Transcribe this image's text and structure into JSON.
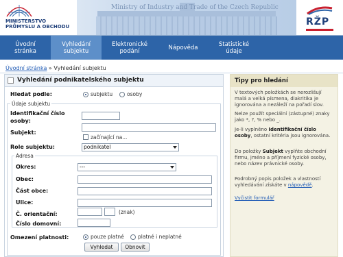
{
  "header": {
    "ministry_line1": "MINISTERSTVO",
    "ministry_line2": "PRŮMYSLU A OBCHODU",
    "tagline": "Ministry of Industry and Trade of the Czech Republic",
    "rzp_logo": "RŽP",
    "colors": {
      "nav_bg": "#2d64a8",
      "nav_active": "#5d8fc9",
      "brand_red": "#c8202f",
      "brand_blue": "#1e3f7a"
    }
  },
  "nav": {
    "items": [
      {
        "line1": "Úvodní",
        "line2": "stránka",
        "active": false
      },
      {
        "line1": "Vyhledání",
        "line2": "subjektu",
        "active": true
      },
      {
        "line1": "Elektronické",
        "line2": "podání",
        "active": false
      },
      {
        "line1": "Nápověda",
        "line2": "",
        "active": false
      },
      {
        "line1": "Statistické",
        "line2": "údaje",
        "active": false
      }
    ]
  },
  "breadcrumb": {
    "home": "Úvodní stránka",
    "separator": "»",
    "current": "Vyhledání subjektu"
  },
  "form": {
    "title": "Vyhledání podnikatelského subjektu",
    "search_by_label": "Hledat podle:",
    "search_by_options": {
      "subject": "subjektu",
      "persons": "osoby"
    },
    "search_by_selected": "subjektu",
    "subject_data_legend": "Údaje subjektu",
    "ico_label": "Identifikační číslo osoby:",
    "ico_value": "",
    "subject_label": "Subjekt:",
    "subject_value": "",
    "starts_with_label": "začínající na...",
    "role_label": "Role subjektu:",
    "role_value": "podnikatel",
    "address_legend": "Adresa",
    "district_label": "Okres:",
    "district_value": "---",
    "municipality_label": "Obec:",
    "municipality_part_label": "Část obce:",
    "street_label": "Ulice:",
    "orientation_no_label": "Č. orientační:",
    "sign_label": "(znak)",
    "house_no_label": "Číslo domovní:",
    "validity_label": "Omezení platnosti:",
    "validity_options": {
      "valid": "pouze platné",
      "all": "platné i neplatné"
    },
    "validity_selected": "pouze platné",
    "search_button": "Vyhledat",
    "reset_button": "Obnovit"
  },
  "tips": {
    "title": "Tipy pro hledání",
    "p1": "V textových položkách se nerozlišují malá a velká písmena, diakritika je ignorována a nezáleží na pořadí slov.",
    "p2": "Nelze použít speciální (zástupné) znaky jako *, ?, % nebo _.",
    "p3_pre": "Je-li vyplněno ",
    "p3_bold": "Identifikační číslo osoby",
    "p3_post": ", ostatní kritéria jsou ignorována.",
    "p4_pre": "Do položky ",
    "p4_bold": "Subjekt",
    "p4_post": " vyplňte obchodní firmu, jméno a příjmení fyzické osoby, nebo název právnické osoby.",
    "p5_pre": "Podrobný popis položek a vlastností vyhledávání získáte v ",
    "p5_link": "nápovědě",
    "p5_post": ".",
    "clear_form_link": "Vyčistit formulář"
  }
}
